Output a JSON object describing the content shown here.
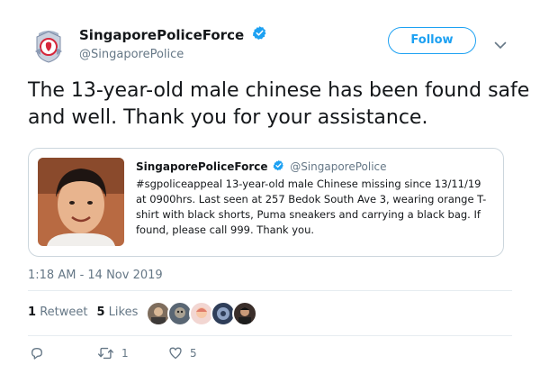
{
  "author": {
    "name": "SingaporePoliceForce",
    "handle": "@SingaporePolice",
    "verified_icon": "verified-badge-icon",
    "avatar_icon": "police-crest-icon"
  },
  "follow_label": "Follow",
  "tweet_text": "The 13-year-old male chinese has been found safe and well. Thank you for your assistance.",
  "quoted_tweet": {
    "name": "SingaporePoliceForce",
    "handle": "@SingaporePolice",
    "text": "#sgpoliceappeal 13-year-old male Chinese missing since 13/11/19 at 0900hrs. Last seen at 257 Bedok South Ave 3, wearing orange T-shirt with black shorts, Puma sneakers and carrying a black bag. If found, please call 999. Thank you."
  },
  "timestamp": "1:18 AM - 14 Nov 2019",
  "stats": {
    "retweets_count": "1",
    "retweets_label": "Retweet",
    "likes_count": "5",
    "likes_label": "Likes"
  },
  "actions": {
    "reply_icon": "reply-icon",
    "retweet_icon": "retweet-icon",
    "retweet_count": "1",
    "like_icon": "heart-icon",
    "like_count": "5"
  },
  "colors": {
    "accent": "#1da1f2",
    "secondary_text": "#657786",
    "border": "#ccd6dd"
  }
}
